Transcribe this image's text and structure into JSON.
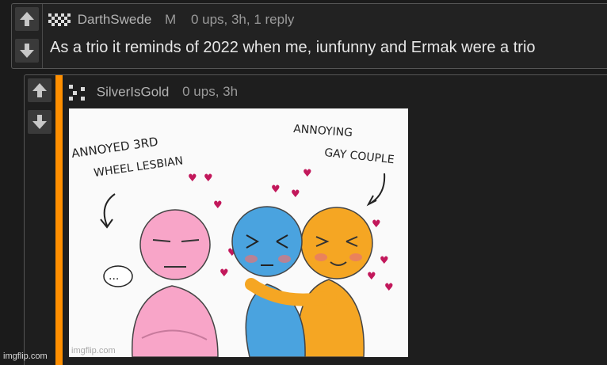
{
  "comment1": {
    "username": "DarthSwede",
    "badge": "M",
    "meta": "0 ups, 3h, 1 reply",
    "text": "As a trio it reminds of 2022 when me, iunfunny and Ermak were a trio"
  },
  "comment2": {
    "username": "SilverIsGold",
    "meta": "0 ups, 3h",
    "accent": "#ff8f00",
    "meme": {
      "label_left_1": "ANNOYED 3RD",
      "label_left_2": "WHEEL LESBIAN",
      "label_right_1": "ANNOYING",
      "label_right_2": "GAY COUPLE",
      "speech": "...",
      "watermark": "imgflip.com"
    }
  },
  "footer": {
    "watermark": "imgflip.com"
  },
  "icons": {
    "upvote": "arrow-up-icon",
    "downvote": "arrow-down-icon"
  }
}
